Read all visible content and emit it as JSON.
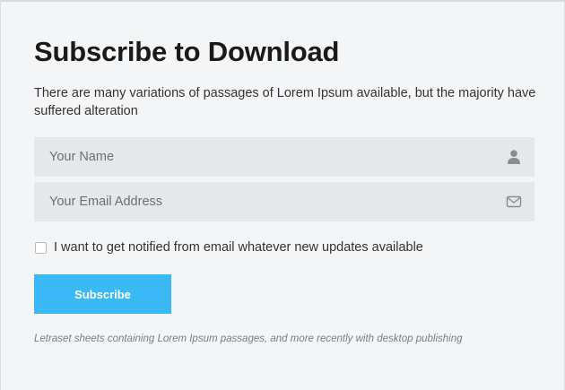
{
  "form": {
    "title": "Subscribe to Download",
    "description": "There are many variations of passages of Lorem Ipsum available, but the majority have suffered alteration",
    "name_field": {
      "placeholder": "Your Name",
      "value": "",
      "icon": "user-icon"
    },
    "email_field": {
      "placeholder": "Your Email Address",
      "value": "",
      "icon": "envelope-icon"
    },
    "consent": {
      "label": "I want to get notified from email whatever new updates available",
      "checked": false
    },
    "submit_label": "Subscribe",
    "footnote": "Letraset sheets containing Lorem Ipsum passages, and more recently with desktop publishing"
  },
  "colors": {
    "accent": "#3bb8f6",
    "panel_bg": "#f4f5f7",
    "field_bg": "#e6e7e9",
    "icon": "#8a8c90"
  }
}
